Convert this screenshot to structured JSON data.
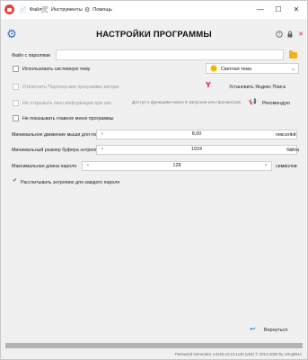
{
  "menu": {
    "file": "Файл",
    "tools": "Инструменты",
    "help": "Помощь"
  },
  "window_controls": {
    "minimize": "—",
    "maximize": "☐",
    "close": "✕"
  },
  "header": {
    "title": "НАСТРОЙКИ ПРОГРАММЫ"
  },
  "form": {
    "password_file": {
      "label": "Файл с паролями",
      "value": ""
    },
    "use_system_theme": {
      "label": "Использовать системную тему",
      "checked": false
    },
    "theme_select": {
      "value": "Светлая тема"
    },
    "disable_partner": {
      "label": "Отключить Партнерские программы автора",
      "disabled": true
    },
    "install_yandex": {
      "label": "Установить Яндекс Поиск"
    },
    "dont_open_info": {
      "label": "Не открывать окно информации при зап",
      "disabled": true
    },
    "info_hint": "Доступ к функциям через 6 запусков или просмотров",
    "recommend": {
      "label": "Рекомендую"
    },
    "hide_main_menu": {
      "label": "Не показывать главное меню программы",
      "checked": false
    },
    "mouse_move": {
      "label": "Минимальное движение мыши для генерации",
      "value": "8,00",
      "unit": "пикселей"
    },
    "entropy_buffer": {
      "label": "Минимальный размер буфера энтропии",
      "value": "1024",
      "unit": "байта"
    },
    "max_length": {
      "label": "Максимальная длина пароля",
      "value": "128",
      "unit": "символов"
    },
    "calc_entropy": {
      "label": "Рассчитывать энтропию для каждого пароля",
      "checked": true
    }
  },
  "footer": {
    "back_label": "Вернуться",
    "copyright": "Password Generator v.3x26.v3.13.1x33 (x64) © 2013-2020 by LRoyBHA"
  },
  "colors": {
    "accent": "#3a6fb0",
    "app_icon": "#e8433a",
    "theme_sun": "#f0b400",
    "folder": "#f2b01e",
    "yandex": "#d6264a"
  }
}
